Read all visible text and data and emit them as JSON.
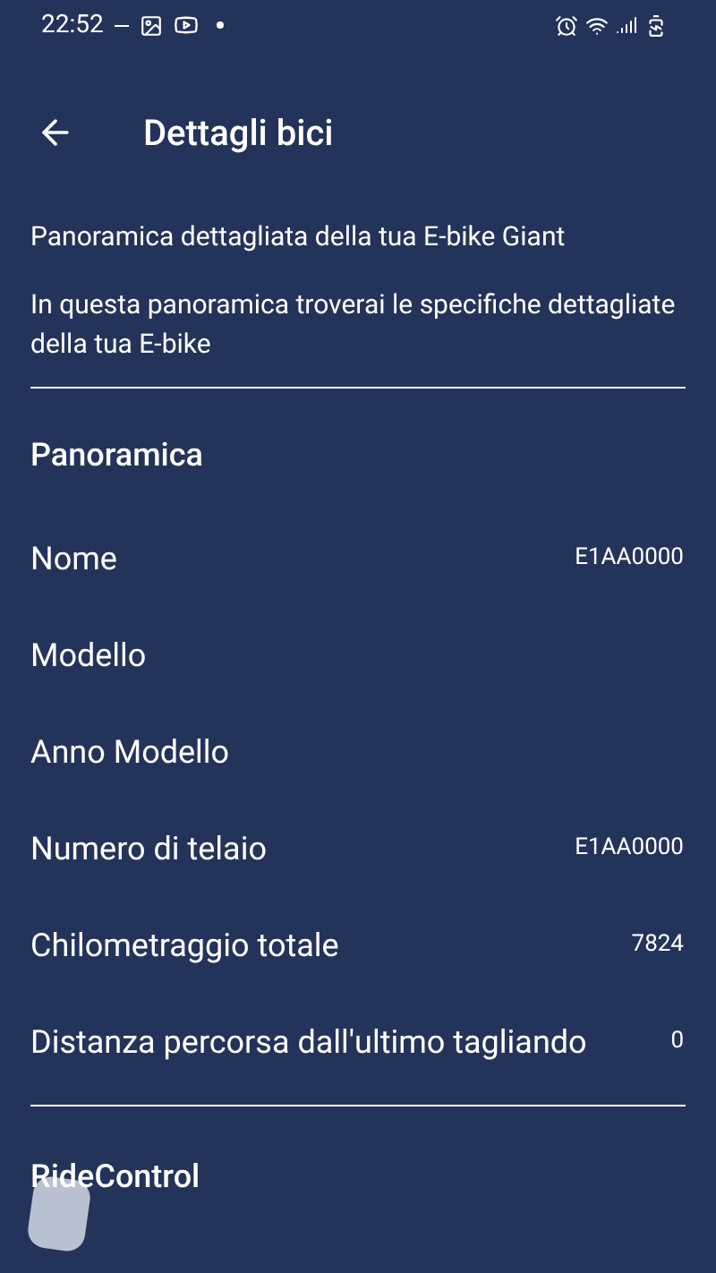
{
  "status_bar": {
    "time": "22:52"
  },
  "header": {
    "title": "Dettagli bici"
  },
  "intro": {
    "subtitle": "Panoramica dettagliata della tua E-bike Giant",
    "description": "In questa panoramica troverai le specifiche dettagliate della tua E-bike"
  },
  "overview": {
    "heading": "Panoramica",
    "rows": [
      {
        "label": "Nome",
        "value": "E1AA0000"
      },
      {
        "label": "Modello"
      },
      {
        "label": "Anno Modello"
      },
      {
        "label": "Numero di telaio",
        "value": "E1AA0000"
      },
      {
        "label": "Chilometraggio totale",
        "value": "7824"
      },
      {
        "label": "Distanza percorsa dall'ultimo tagliando",
        "value": "0"
      }
    ]
  },
  "next_section": {
    "heading": "RideControl"
  }
}
